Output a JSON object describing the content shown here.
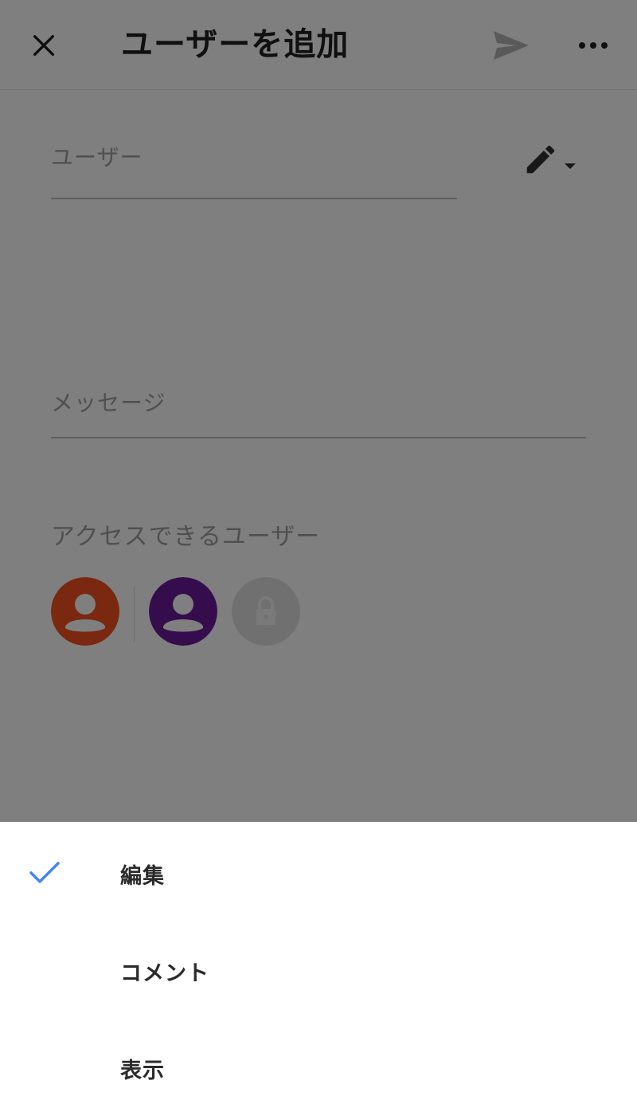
{
  "appbar": {
    "title": "ユーザーを追加",
    "close_icon": "close-icon",
    "send_icon": "send-icon",
    "more_icon": "more-horiz-icon"
  },
  "form": {
    "user_placeholder": "ユーザー",
    "message_placeholder": "メッセージ",
    "permission_icon": "pencil-icon"
  },
  "access": {
    "label": "アクセスできるユーザー",
    "avatars": [
      {
        "icon": "person-icon",
        "color": "#f4511e"
      },
      {
        "icon": "person-icon",
        "color": "#6a1b9a"
      },
      {
        "icon": "lock-icon",
        "color": "#e0e0e0"
      }
    ]
  },
  "permission_menu": {
    "items": [
      {
        "label": "編集",
        "selected": true
      },
      {
        "label": "コメント",
        "selected": false
      },
      {
        "label": "表示",
        "selected": false
      }
    ],
    "check_color": "#4285f4"
  },
  "colors": {
    "scrim": "rgba(0,0,0,0.5)"
  }
}
